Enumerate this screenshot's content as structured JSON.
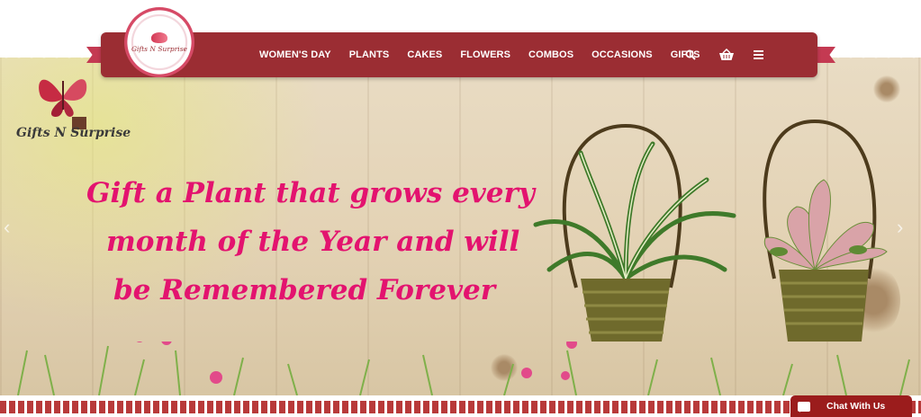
{
  "brand": {
    "seal_text": "Gifts N Surprise",
    "corner_logo_text": "Gifts N Surprise"
  },
  "nav": {
    "links": [
      "WOMEN'S DAY",
      "PLANTS",
      "CAKES",
      "FLOWERS",
      "COMBOS",
      "OCCASIONS",
      "GIFTS"
    ],
    "icons": [
      "search-icon",
      "cart-basket-icon",
      "menu-icon"
    ]
  },
  "hero": {
    "headline_lines": [
      "Gift a Plant that grows every",
      "month of the Year and will",
      "be Remembered Forever"
    ]
  },
  "chat": {
    "label": "Chat With Us"
  },
  "colors": {
    "nav_bar": "#9b2d33",
    "headline": "#e3136f",
    "chat": "#9b1c1c",
    "wood": "#e6d7bd"
  }
}
